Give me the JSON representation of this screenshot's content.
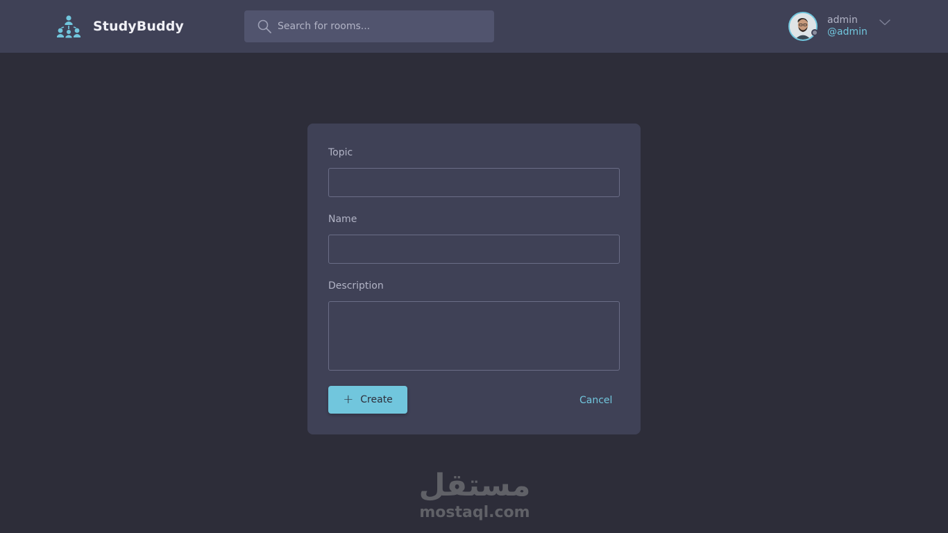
{
  "header": {
    "brand": "StudyBuddy",
    "search": {
      "placeholder": "Search for rooms...",
      "value": ""
    },
    "user": {
      "name": "admin",
      "handle": "@admin"
    }
  },
  "form": {
    "topic_label": "Topic",
    "topic_value": "",
    "name_label": "Name",
    "name_value": "",
    "description_label": "Description",
    "description_value": "",
    "create_label": "Create",
    "cancel_label": "Cancel"
  },
  "watermark": {
    "arabic": "مستقل",
    "latin": "mostaql.com"
  },
  "colors": {
    "background": "#2d2d39",
    "surface": "#3f4156",
    "search_bg": "#51546e",
    "accent": "#71c6dd",
    "muted_text": "#b2b4c6"
  },
  "icons": {
    "logo": "group-network-icon",
    "search": "search-icon",
    "dropdown": "chevron-down-icon",
    "add": "plus-icon"
  }
}
